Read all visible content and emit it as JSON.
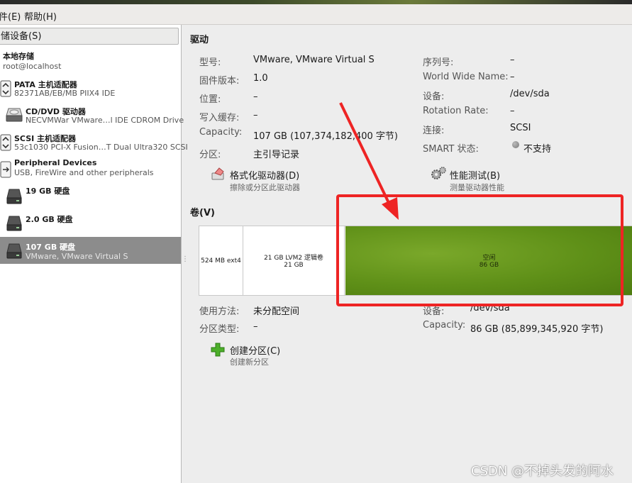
{
  "menu": {
    "file": "件(E)",
    "help": "帮助(H)"
  },
  "sidebar": {
    "header": "储设备(S)",
    "items": [
      {
        "title": "本地存储",
        "sub": "root@localhost",
        "icon": "none"
      },
      {
        "title": "PATA 主机适配器",
        "sub": "82371AB/EB/MB PIIX4 IDE",
        "icon": "controller-icon"
      },
      {
        "title": "CD/DVD 驱动器",
        "sub": "NECVMWar VMware…l IDE CDROM Drive",
        "icon": "optical-drive-icon"
      },
      {
        "title": "SCSI 主机适配器",
        "sub": "53c1030 PCI-X Fusion…T Dual Ultra320 SCSI",
        "icon": "controller-icon"
      },
      {
        "title": "Peripheral Devices",
        "sub": "USB, FireWire and other peripherals",
        "icon": "usb-icon"
      },
      {
        "title": "19 GB 硬盘",
        "sub": "",
        "icon": "hard-disk-icon"
      },
      {
        "title": "2.0 GB 硬盘",
        "sub": "",
        "icon": "hard-disk-icon"
      },
      {
        "title": "107 GB 硬盘",
        "sub": "VMware, VMware Virtual S",
        "icon": "hard-disk-icon"
      }
    ]
  },
  "drive": {
    "section_title": "驱动",
    "left": [
      {
        "label": "型号:",
        "value": "VMware, VMware Virtual S"
      },
      {
        "label": "固件版本:",
        "value": "1.0"
      },
      {
        "label": "位置:",
        "value": "–"
      },
      {
        "label": "写入缓存:",
        "value": "–"
      },
      {
        "label": "Capacity:",
        "value": "107 GB (107,374,182,400 字节)"
      },
      {
        "label": "分区:",
        "value": "主引导记录"
      }
    ],
    "right": [
      {
        "label": "序列号:",
        "value": "–"
      },
      {
        "label": "World Wide Name:",
        "value": "–"
      },
      {
        "label": "设备:",
        "value": "/dev/sda"
      },
      {
        "label": "Rotation Rate:",
        "value": "–"
      },
      {
        "label": "连接:",
        "value": "SCSI"
      },
      {
        "label": "SMART 状态:",
        "value": "不支持"
      }
    ],
    "format_action": {
      "label": "格式化驱动器(D)",
      "sub": "擦除或分区此驱动器"
    },
    "benchmark_action": {
      "label": "性能测试(B)",
      "sub": "测量驱动器性能"
    }
  },
  "volumes": {
    "section_title": "卷(V)",
    "segments": [
      {
        "line1": "524 MB ext4",
        "line2": ""
      },
      {
        "line1": "21 GB LVM2 逻辑卷",
        "line2": "21 GB"
      },
      {
        "line1": "空闲",
        "line2": "86 GB"
      }
    ],
    "left": [
      {
        "label": "使用方法:",
        "value": "未分配空间"
      },
      {
        "label": "分区类型:",
        "value": "–"
      }
    ],
    "right": [
      {
        "label": "设备:",
        "value": "/dev/sda"
      },
      {
        "label": "Capacity:",
        "value": "86 GB (85,899,345,920 字节)"
      }
    ],
    "create_action": {
      "label": "创建分区(C)",
      "sub": "创建新分区"
    }
  },
  "watermark": "CSDN @不掉头发的阿水",
  "colors": {
    "free_space": "#5f9018",
    "highlight_box": "#ee2424",
    "arrow": "#ee2424",
    "selected_item": "#8c8c8c"
  }
}
